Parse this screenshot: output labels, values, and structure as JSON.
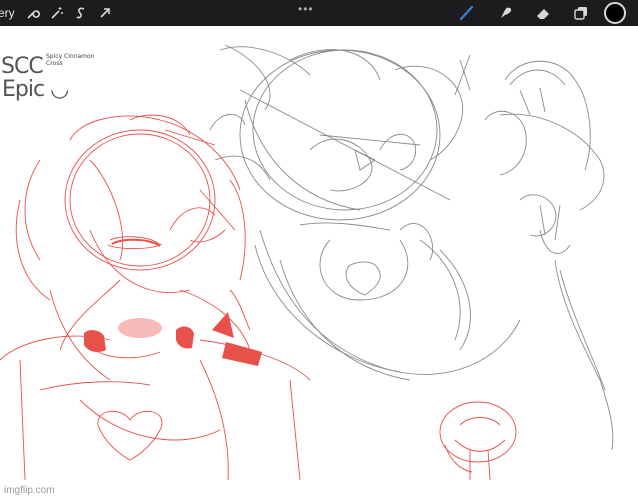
{
  "toolbar": {
    "gallery_label": "ery",
    "left_tools": [
      "wrench-icon",
      "magic-wand-icon",
      "selection-icon",
      "transform-arrow-icon"
    ],
    "dots": "•••",
    "right_tools": [
      "brush-icon",
      "smudge-icon",
      "eraser-icon",
      "layers-icon"
    ],
    "current_color": "#000000"
  },
  "canvas": {
    "text_scc": "SCC",
    "text_scc_note": "Spicy Cinnamon Cross",
    "text_epic": "Epic",
    "face": "◡",
    "sketch_colors": {
      "red": "#e8504a",
      "gray": "#8a8a8a",
      "blush": "#f5a7a7"
    }
  },
  "watermark": "imgflip.com"
}
